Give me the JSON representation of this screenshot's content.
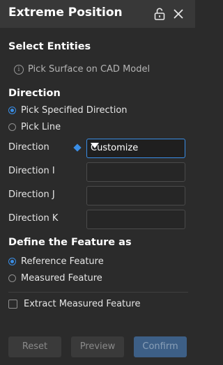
{
  "window": {
    "title": "Extreme Position",
    "lock_icon": "unlock-icon",
    "close_icon": "close-icon"
  },
  "select_entities": {
    "heading": "Select Entities",
    "hint": "Pick Surface on CAD Model",
    "hint_icon": "info-icon"
  },
  "direction": {
    "heading": "Direction",
    "options": [
      {
        "label": "Pick Specified Direction",
        "selected": true
      },
      {
        "label": "Pick Line",
        "selected": false
      }
    ],
    "direction_label": "Direction",
    "direction_value": "Customize",
    "direction_i_label": "Direction I",
    "direction_j_label": "Direction J",
    "direction_k_label": "Direction K",
    "direction_i_value": "",
    "direction_j_value": "",
    "direction_k_value": ""
  },
  "feature": {
    "heading": "Define the Feature as",
    "options": [
      {
        "label": "Reference Feature",
        "selected": true
      },
      {
        "label": "Measured Feature",
        "selected": false
      }
    ],
    "extract_label": "Extract Measured Feature",
    "extract_checked": false
  },
  "footer": {
    "reset_label": "Reset",
    "preview_label": "Preview",
    "confirm_label": "Confirm"
  },
  "colors": {
    "accent": "#3a8ee6",
    "background": "#2b2b2b",
    "titlebar": "#383838"
  }
}
